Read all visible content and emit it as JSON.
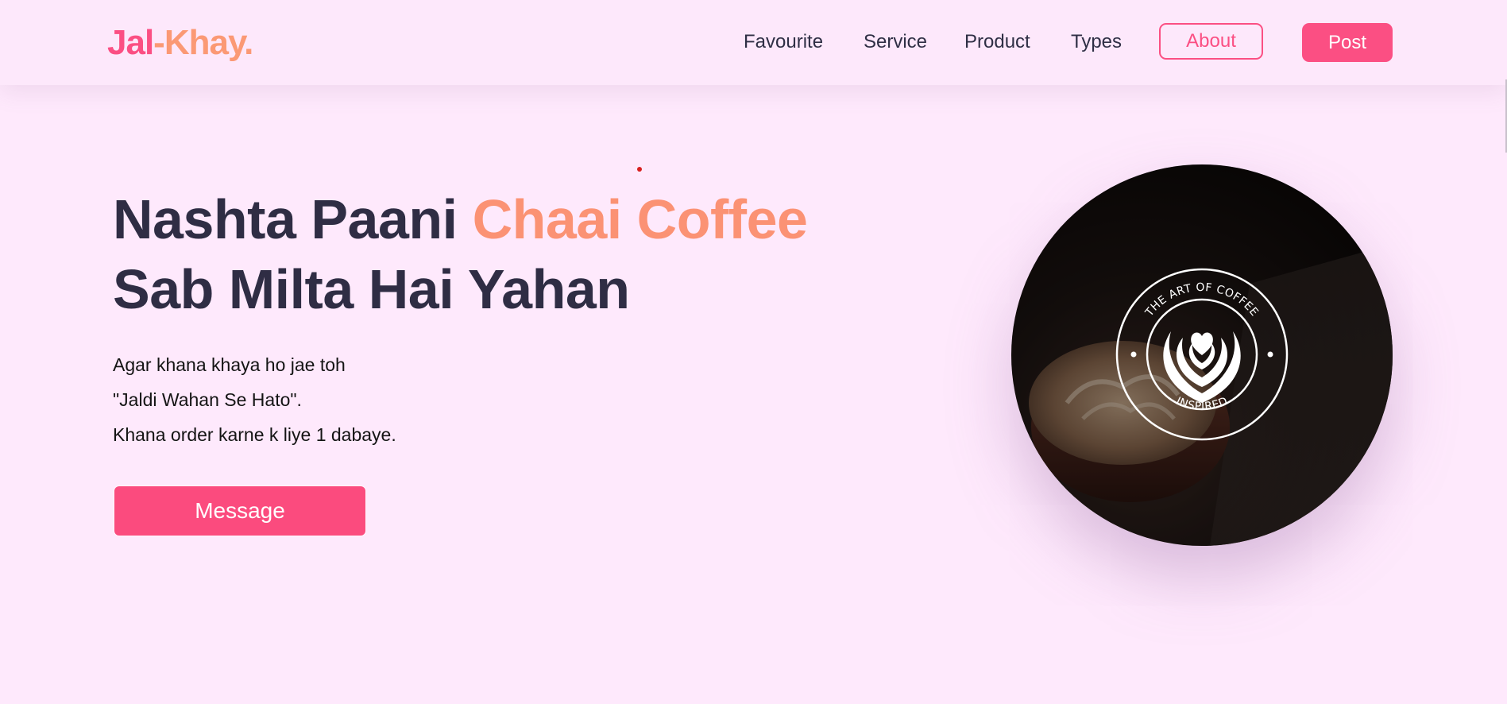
{
  "header": {
    "logo": {
      "part1": "Jal",
      "part2": "-Khay."
    },
    "nav": [
      {
        "label": "Favourite",
        "name": "nav-favourite"
      },
      {
        "label": "Service",
        "name": "nav-service"
      },
      {
        "label": "Product",
        "name": "nav-product"
      },
      {
        "label": "Types",
        "name": "nav-types"
      }
    ],
    "about_label": "About",
    "post_label": "Post"
  },
  "hero": {
    "title_part1": "Nashta Paani ",
    "title_accent": "Chaai Coffee",
    "title_line2": "Sab Milta Hai Yahan",
    "lines": [
      "Agar khana khaya ho jae toh",
      "\"Jaldi Wahan Se Hato\".",
      "Khana order karne k liye 1 dabaye."
    ],
    "button_label": "Message",
    "image": {
      "emblem_top_text": "THE ART OF COFFEE",
      "emblem_bottom_text": "INSPIRED"
    }
  },
  "colors": {
    "background": "#fee9fc",
    "brand_pink": "#fb4f83",
    "brand_orange": "#fb9975",
    "heading": "#2f2d44"
  }
}
